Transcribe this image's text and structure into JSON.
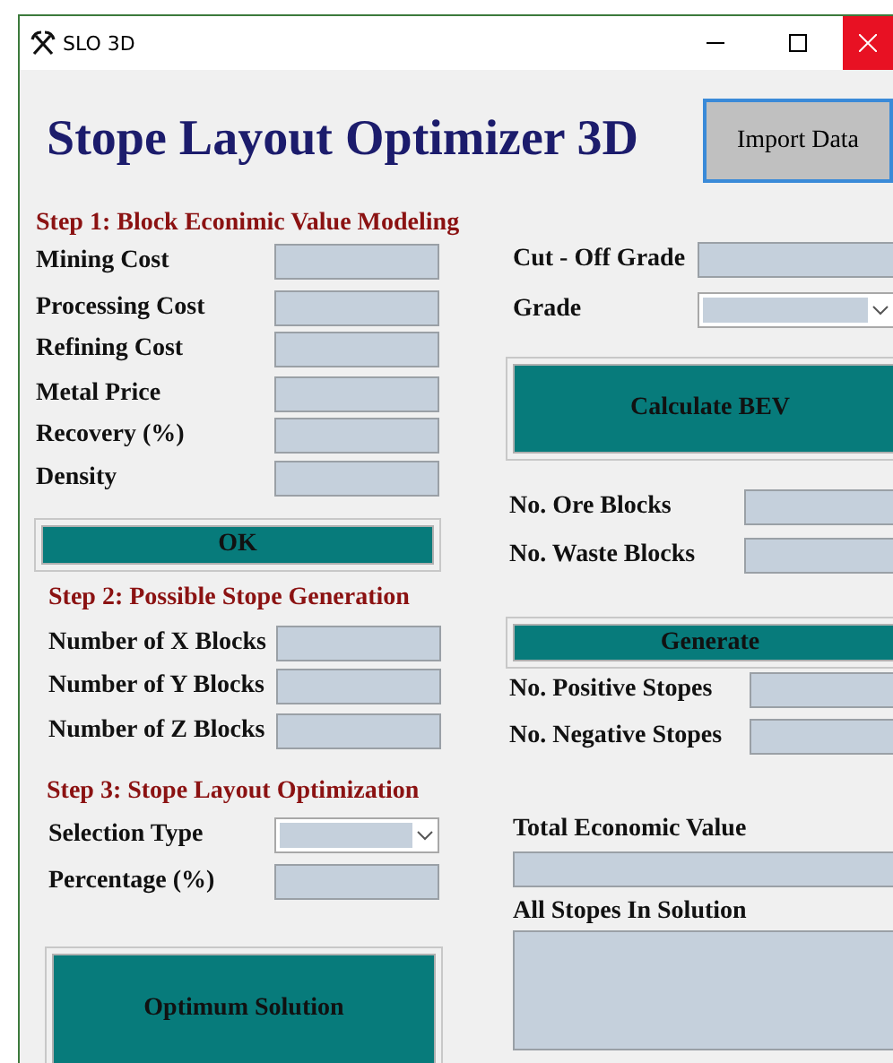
{
  "window": {
    "title": "SLO 3D"
  },
  "header": {
    "title": "Stope Layout Optimizer 3D",
    "import_button": "Import Data"
  },
  "step1": {
    "heading": "Step 1: Block Econimic Value Modeling",
    "fields": [
      {
        "label": "Mining Cost",
        "kind": "text"
      },
      {
        "label": "Processing Cost",
        "kind": "text"
      },
      {
        "label": "Refining Cost",
        "kind": "text"
      },
      {
        "label": "Metal Price",
        "kind": "text"
      },
      {
        "label": "Recovery (%)",
        "kind": "text"
      },
      {
        "label": "Density",
        "kind": "text"
      }
    ],
    "button": "OK"
  },
  "bev": {
    "fields": [
      {
        "label": "Cut - Off Grade",
        "kind": "text"
      },
      {
        "label": "Grade",
        "kind": "dropdown"
      }
    ],
    "button": "Calculate BEV",
    "outputs": [
      {
        "label": "No. Ore Blocks",
        "kind": "text"
      },
      {
        "label": "No. Waste Blocks",
        "kind": "text"
      }
    ]
  },
  "step2": {
    "heading": "Step 2: Possible Stope Generation",
    "fields": [
      {
        "label": "Number of X Blocks",
        "kind": "text"
      },
      {
        "label": "Number of Y Blocks",
        "kind": "text"
      },
      {
        "label": "Number of Z Blocks",
        "kind": "text"
      }
    ]
  },
  "generate": {
    "button": "Generate",
    "outputs": [
      {
        "label": "No. Positive Stopes",
        "kind": "text"
      },
      {
        "label": "No. Negative Stopes",
        "kind": "text"
      }
    ]
  },
  "step3": {
    "heading": "Step 3: Stope Layout Optimization",
    "fields": [
      {
        "label": "Selection Type",
        "kind": "dropdown"
      },
      {
        "label": "Percentage (%)",
        "kind": "text"
      }
    ],
    "button": "Optimum Solution"
  },
  "results": {
    "total_label": "Total Economic Value",
    "stopes_label": "All Stopes In Solution"
  }
}
